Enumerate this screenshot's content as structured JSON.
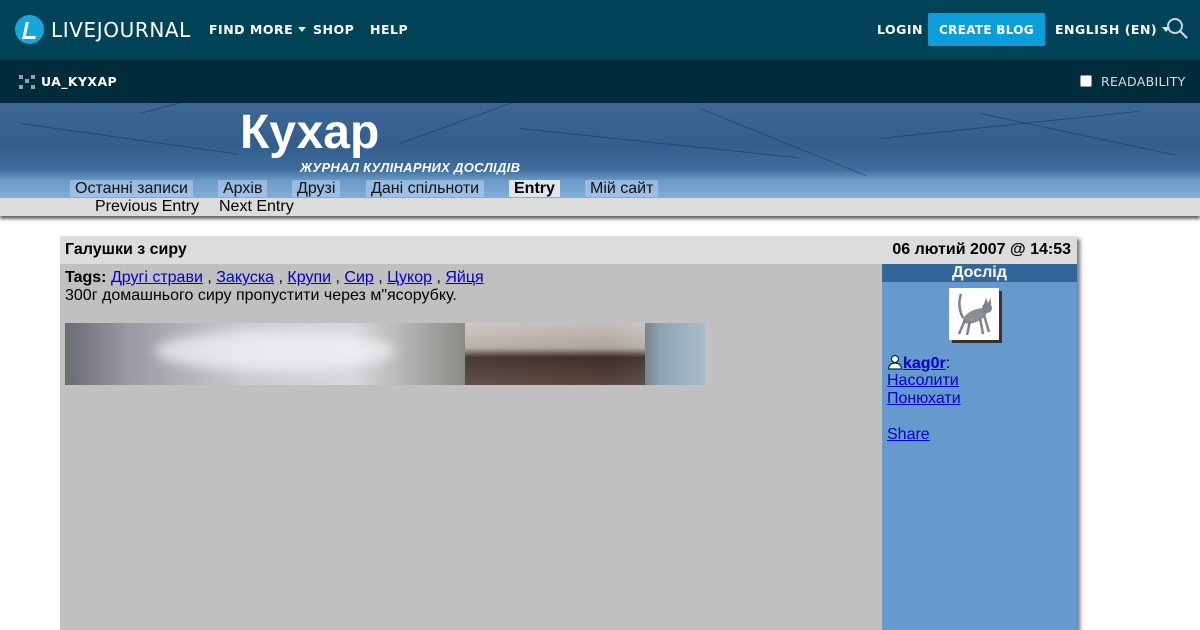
{
  "topbar": {
    "logo_text": "LIVEJOURNAL",
    "nav": {
      "find_more": "FIND MORE",
      "shop": "SHOP",
      "help": "HELP"
    },
    "login": "LOGIN",
    "create_blog": "CREATE BLOG",
    "language": "ENGLISH (EN)",
    "icons": {
      "search": "search-icon"
    }
  },
  "subbar": {
    "username": "UA_KYXAP",
    "readability": "READABILITY"
  },
  "journal": {
    "title": "Кухар",
    "subtitle": "ЖУРНАЛ КУЛІНАРНИХ ДОСЛІДІВ",
    "tabs": [
      {
        "label": "Останні записи"
      },
      {
        "label": "Архів"
      },
      {
        "label": "Друзі"
      },
      {
        "label": "Дані спільноти"
      },
      {
        "label": "Entry"
      },
      {
        "label": "Мій сайт"
      }
    ],
    "active_tab": "Entry",
    "entry_nav": {
      "previous": "Previous Entry",
      "next": "Next Entry"
    }
  },
  "entry": {
    "subject": "Галушки з сиру",
    "date": "06 лютий 2007 @ 14:53",
    "tags_label": "Tags:",
    "tags": [
      "Другі страви",
      "Закуска",
      "Крупи",
      "Сир",
      "Цукор",
      "Яйця"
    ],
    "separator": ",",
    "text": "300г домашнього сиру пропустити через м\"ясорубку.",
    "sidebar": {
      "heading": "Дослід",
      "author": "kag0r",
      "author_suffix": ":",
      "links": {
        "post": "Насолити",
        "track": "Понюхати",
        "share": "Share"
      }
    }
  },
  "colors": {
    "topbar": "#004359",
    "subbar": "#002b3b",
    "accent_button": "#0c9ed8",
    "entry_body": "#c0c0c0",
    "sidebar": "#6699cc",
    "sidebar_heading": "#336699",
    "link": "#0000cc"
  }
}
